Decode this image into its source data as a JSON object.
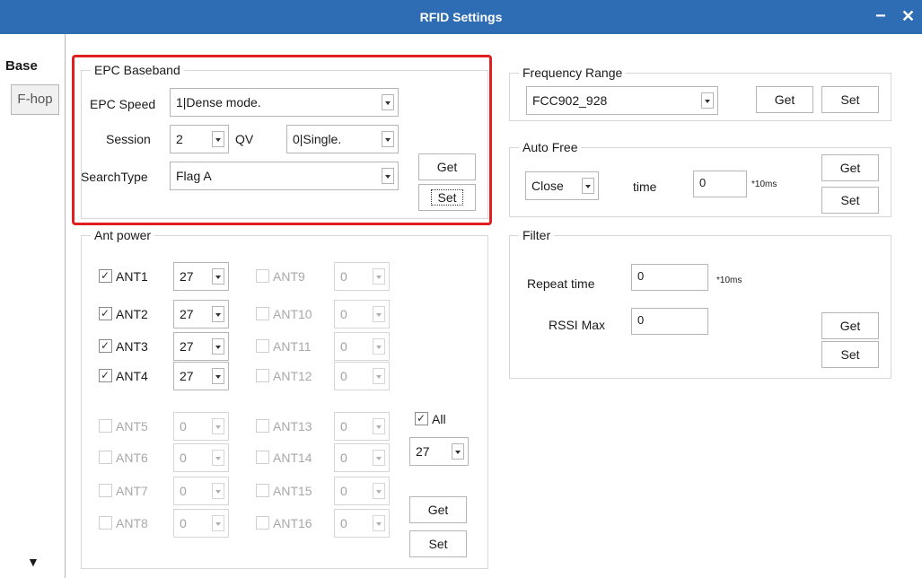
{
  "window": {
    "title": "RFID Settings",
    "minimize": "−",
    "close": "✕"
  },
  "tabs": {
    "base": "Base",
    "fhop": "F-hop",
    "scroll": "▼"
  },
  "epc": {
    "legend": "EPC Baseband",
    "speed_label": "EPC Speed",
    "speed_value": "1|Dense mode.",
    "session_label": "Session",
    "session_value": "2",
    "qv_label": "QV",
    "qv_value": "0|Single.",
    "searchtype_label": "SearchType",
    "searchtype_value": "Flag A",
    "get": "Get",
    "set": "Set"
  },
  "ant": {
    "legend": "Ant power",
    "col1": [
      {
        "name": "ANT1",
        "checked": true,
        "power": "27"
      },
      {
        "name": "ANT2",
        "checked": true,
        "power": "27"
      },
      {
        "name": "ANT3",
        "checked": true,
        "power": "27"
      },
      {
        "name": "ANT4",
        "checked": true,
        "power": "27"
      },
      {
        "name": "ANT5",
        "checked": false,
        "power": "0"
      },
      {
        "name": "ANT6",
        "checked": false,
        "power": "0"
      },
      {
        "name": "ANT7",
        "checked": false,
        "power": "0"
      },
      {
        "name": "ANT8",
        "checked": false,
        "power": "0"
      }
    ],
    "col2": [
      {
        "name": "ANT9",
        "checked": false,
        "power": "0"
      },
      {
        "name": "ANT10",
        "checked": false,
        "power": "0"
      },
      {
        "name": "ANT11",
        "checked": false,
        "power": "0"
      },
      {
        "name": "ANT12",
        "checked": false,
        "power": "0"
      },
      {
        "name": "ANT13",
        "checked": false,
        "power": "0"
      },
      {
        "name": "ANT14",
        "checked": false,
        "power": "0"
      },
      {
        "name": "ANT15",
        "checked": false,
        "power": "0"
      },
      {
        "name": "ANT16",
        "checked": false,
        "power": "0"
      }
    ],
    "all_label": "All",
    "all_power": "27",
    "get": "Get",
    "set": "Set"
  },
  "freq": {
    "legend": "Frequency Range",
    "value": "FCC902_928",
    "get": "Get",
    "set": "Set"
  },
  "autofree": {
    "legend": "Auto Free",
    "value": "Close",
    "time_label": "time",
    "time_value": "0",
    "unit": "*10ms",
    "get": "Get",
    "set": "Set"
  },
  "filter": {
    "legend": "Filter",
    "repeat_label": "Repeat time",
    "repeat_value": "0",
    "unit": "*10ms",
    "rssi_label": "RSSI Max",
    "rssi_value": "0",
    "get": "Get",
    "set": "Set"
  },
  "colors": {
    "titlebar": "#2e6db3",
    "highlight": "#e02020"
  }
}
